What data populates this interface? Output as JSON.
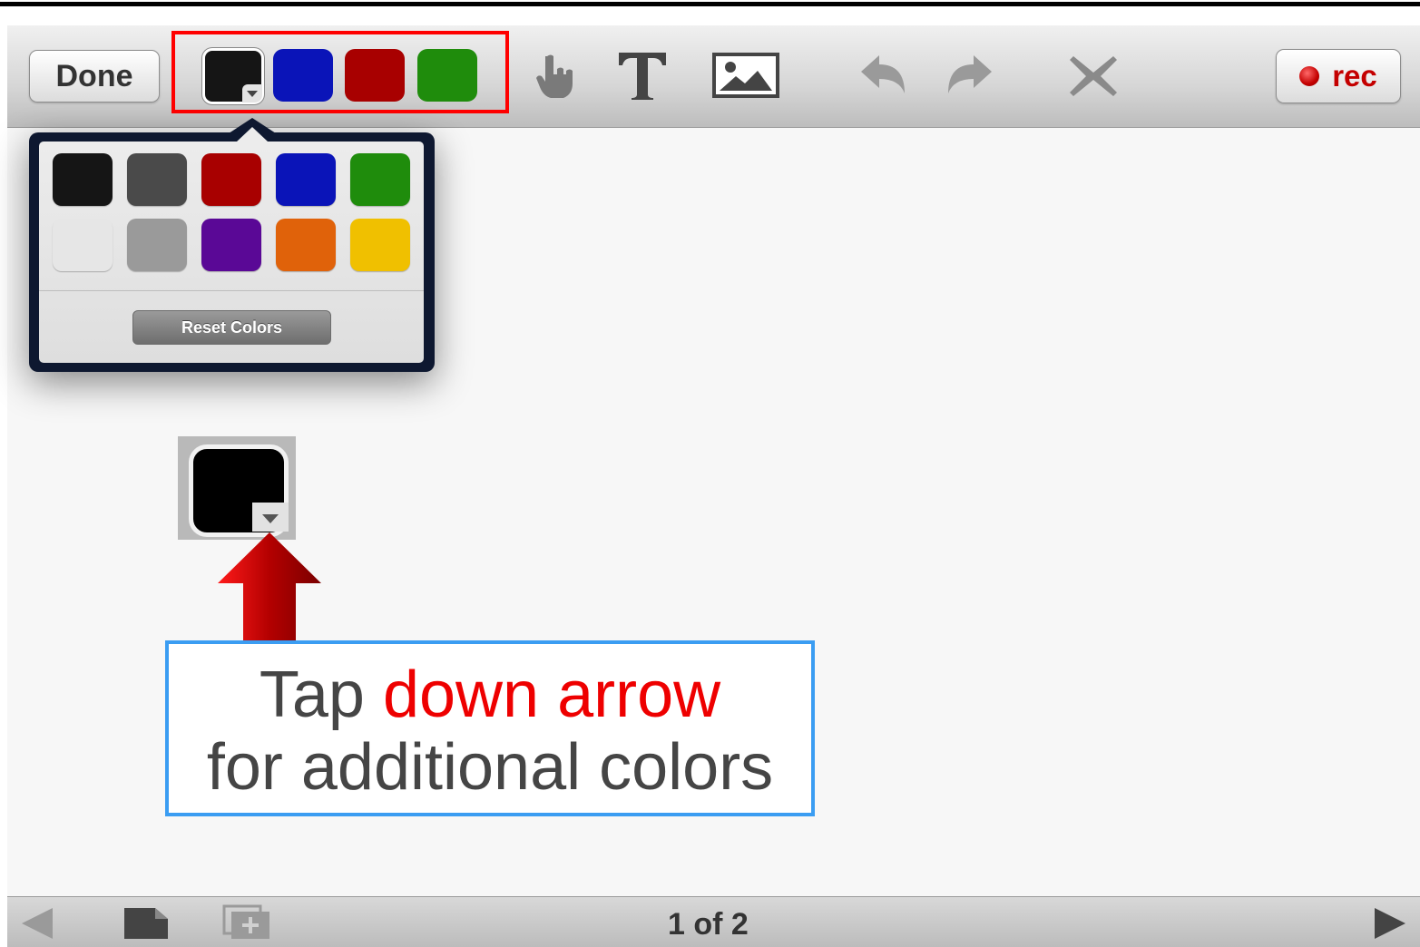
{
  "toolbar": {
    "done_label": "Done",
    "rec_label": "rec",
    "quick_colors": [
      {
        "name": "black",
        "hex": "#151515",
        "selected": true
      },
      {
        "name": "blue",
        "hex": "#0a14b8"
      },
      {
        "name": "red",
        "hex": "#a80000"
      },
      {
        "name": "green",
        "hex": "#1f8c0c"
      }
    ],
    "tool_icons": [
      "hand-pointer-icon",
      "text-tool-icon",
      "image-insert-icon",
      "undo-icon",
      "redo-icon",
      "clear-icon"
    ]
  },
  "color_popover": {
    "palette": [
      "#151515",
      "#4a4a4a",
      "#a80000",
      "#0a14b8",
      "#1f8c0c",
      "#e6e6e6",
      "#9a9a9a",
      "#5a0896",
      "#e0620a",
      "#f0c000"
    ],
    "reset_label": "Reset Colors"
  },
  "callout": {
    "word1": "Tap",
    "highlight": "down arrow",
    "line2": "for additional colors",
    "border_color": "#3b9df2",
    "highlight_color": "#ee0000"
  },
  "bottom_bar": {
    "page_indicator": "1 of 2",
    "icons": [
      "prev-page-icon",
      "page-icon",
      "add-page-icon",
      "next-page-icon"
    ]
  },
  "accent_colors": {
    "annotation_red": "#ff0000",
    "record_red": "#c40000"
  }
}
